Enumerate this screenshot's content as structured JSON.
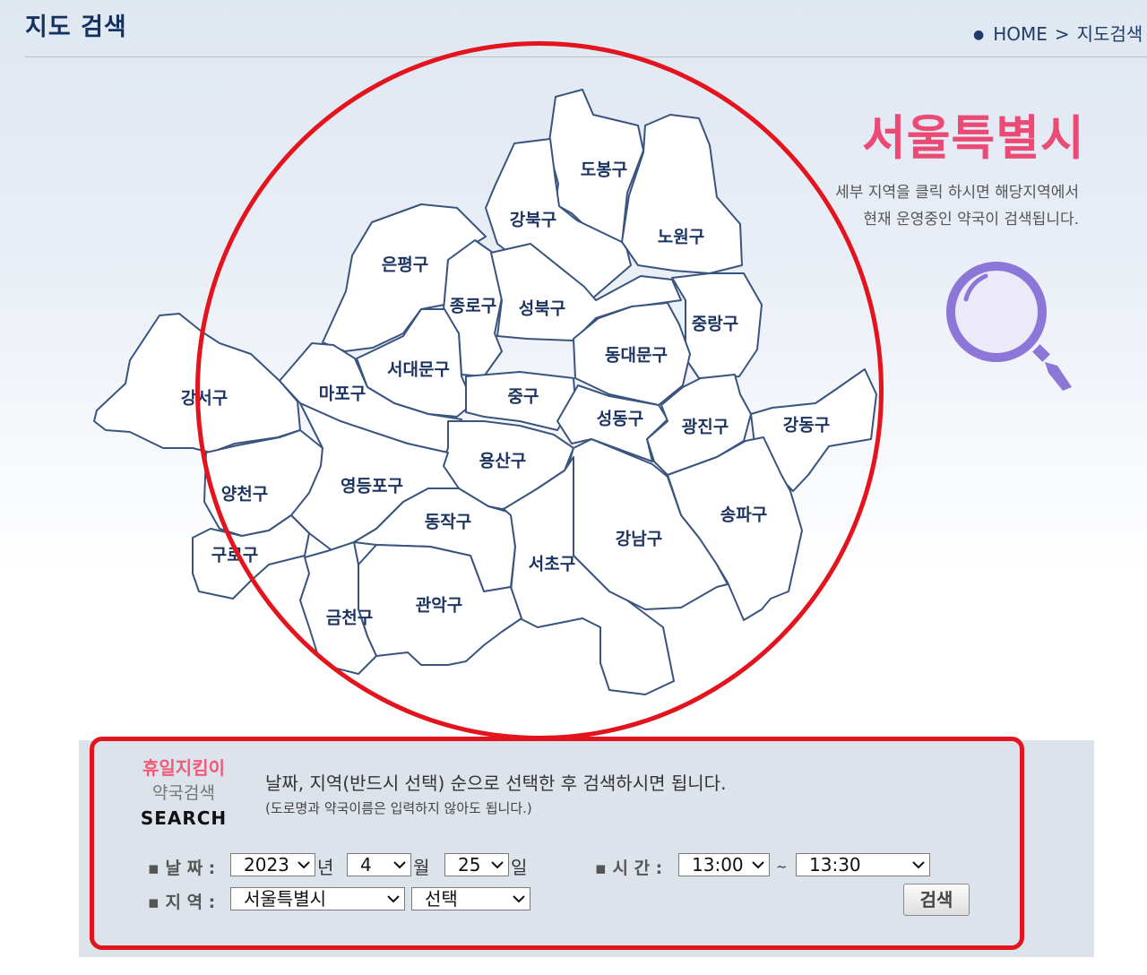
{
  "header": {
    "title": "지도 검색",
    "breadcrumb": {
      "home": "HOME",
      "separator": ">",
      "current": "지도검색"
    }
  },
  "city": {
    "name": "서울특별시",
    "description_line1": "세부 지역을 클릭 하시면 해당지역에서",
    "description_line2": "현재 운영중인 약국이 검색됩니다."
  },
  "map": {
    "districts": [
      "도봉구",
      "강북구",
      "노원구",
      "은평구",
      "종로구",
      "성북구",
      "중랑구",
      "동대문구",
      "서대문구",
      "마포구",
      "강서구",
      "중구",
      "성동구",
      "광진구",
      "강동구",
      "용산구",
      "양천구",
      "영등포구",
      "동작구",
      "송파구",
      "강남구",
      "서초구",
      "구로구",
      "관악구",
      "금천구"
    ]
  },
  "search": {
    "brand_line1": "휴일지킴이",
    "brand_line2": "약국검색",
    "brand_line3": "SEARCH",
    "guide": "날짜, 지역(반드시 선택) 순으로 선택한 후 검색하시면 됩니다.",
    "guide_sub": "(도로명과 약국이름은 입력하지 않아도 됩니다.)",
    "date_label": "▪ 날 짜 :",
    "year": "2023",
    "year_unit": "년",
    "month": "4",
    "month_unit": "월",
    "day": "25",
    "day_unit": "일",
    "time_label": "▪ 시 간 :",
    "time_from": "13:00",
    "time_separator": "~",
    "time_to": "13:30",
    "region_label": "▪ 지 역 :",
    "region_city": "서울특별시",
    "region_district": "선택",
    "button": "검색"
  },
  "colors": {
    "title_navy": "#14325f",
    "city_pink": "#ea4a74",
    "highlight_red": "#e3141d",
    "magnifier_purple": "#8c77d8",
    "brand_pink": "#f05a78"
  },
  "icons": [
    "magnifier-icon",
    "chevron-down-icon"
  ]
}
